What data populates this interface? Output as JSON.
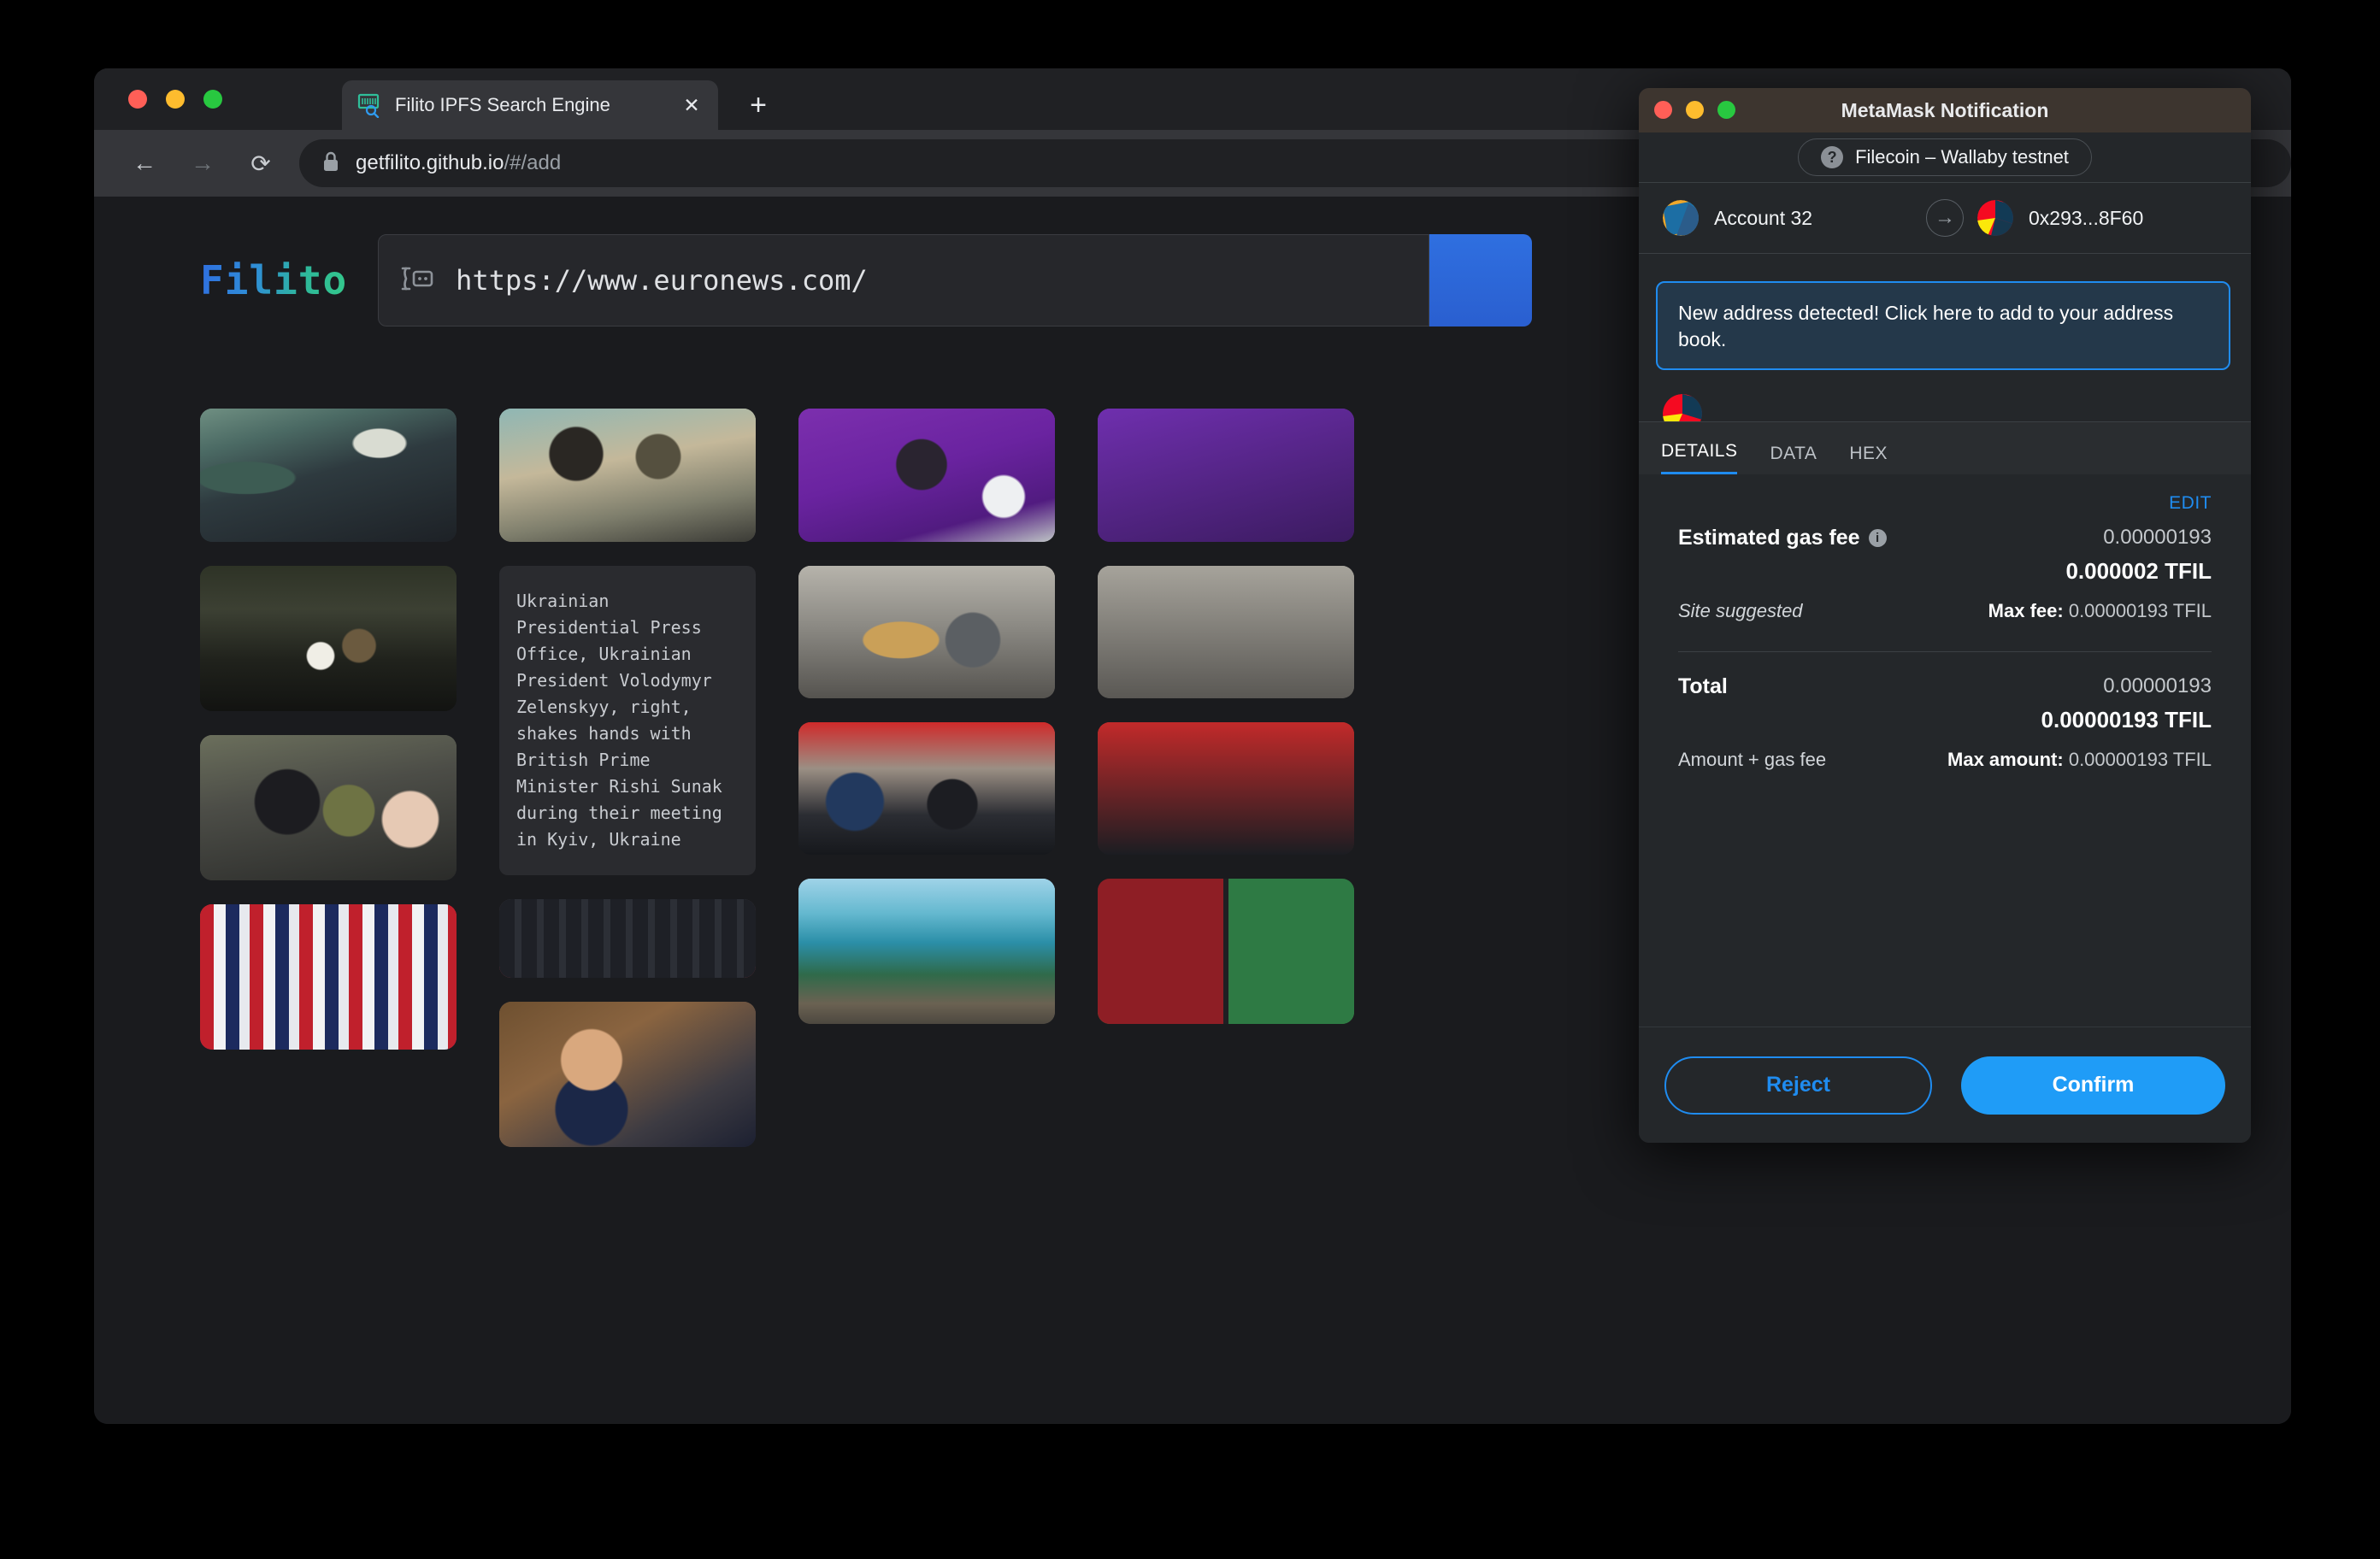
{
  "browser": {
    "tab": {
      "title": "Filito IPFS Search Engine",
      "favicon": "barcode-search-icon",
      "close_label": "✕"
    },
    "new_tab_label": "+",
    "nav": {
      "back": "←",
      "forward": "→",
      "reload": "⟳"
    },
    "omnibox": {
      "lock_icon": "lock-icon",
      "domain": "getfilito.github.io",
      "path": "/#/add"
    },
    "traffic_lights": [
      "close",
      "minimize",
      "maximize"
    ]
  },
  "page": {
    "logo_text": "Filito",
    "search": {
      "icon": "ipfs-cube-icon",
      "value": "https://www.euronews.com/",
      "submit_label": ""
    },
    "grid": {
      "columns": [
        {
          "items": [
            {
              "type": "image",
              "name": "military-funeral-coffin",
              "height": 156
            },
            {
              "type": "image",
              "name": "kim-jong-un-daughter-missile",
              "height": 170
            },
            {
              "type": "image",
              "name": "soldier-kiss-reunion",
              "height": 170
            },
            {
              "type": "image",
              "name": "budweiser-world-is-yours-collage",
              "height": 170
            }
          ]
        },
        {
          "items": [
            {
              "type": "image",
              "name": "sunak-zelenskyy-handshake",
              "height": 156
            },
            {
              "type": "text",
              "name": "caption-card",
              "text": "Ukrainian Presidential Press Office, Ukrainian President Volodymyr Zelenskyy, right, shakes hands with British Prime Minister Rishi Sunak during their meeting in Kyiv, Ukraine"
            },
            {
              "type": "image",
              "name": "red-carpet-lineup",
              "height": 90
            },
            {
              "type": "image",
              "name": "donald-trump-portrait",
              "height": 170
            }
          ]
        },
        {
          "items": [
            {
              "type": "image",
              "name": "fifa-infantino-press-conference",
              "height": 156
            },
            {
              "type": "image",
              "name": "baker-bread-oven",
              "height": 155
            },
            {
              "type": "image",
              "name": "istanbul-memorial-crowd",
              "height": 155
            },
            {
              "type": "image",
              "name": "coastal-sea-rocks",
              "height": 170
            }
          ]
        },
        {
          "items": [
            {
              "type": "image",
              "name": "hidden-card-upper",
              "height": 156
            },
            {
              "type": "image",
              "name": "hidden-card-mid",
              "height": 155
            },
            {
              "type": "image",
              "name": "hidden-card-lower",
              "height": 155
            },
            {
              "type": "image",
              "name": "football-highlights-collage",
              "height": 170
            }
          ]
        }
      ]
    }
  },
  "metamask": {
    "window_title": "MetaMask Notification",
    "network": {
      "icon": "question-mark-icon",
      "name": "Filecoin – Wallaby testnet"
    },
    "from_account": {
      "label": "Account 32",
      "identicon": "blue-orange-identicon"
    },
    "to_account": {
      "label": "0x293...8F60",
      "identicon": "red-yellow-navy-identicon"
    },
    "transfer_arrow": "→",
    "address_banner": "New address detected! Click here to add to your address book.",
    "tabs": [
      {
        "label": "DETAILS",
        "active": true
      },
      {
        "label": "DATA",
        "active": false
      },
      {
        "label": "HEX",
        "active": false
      }
    ],
    "edit_label": "EDIT",
    "gas": {
      "label": "Estimated gas fee",
      "info_icon": "info-icon",
      "alt_value": "0.00000193",
      "main_value": "0.000002 TFIL",
      "sub_left": "Site suggested",
      "sub_right_label": "Max fee:",
      "sub_right_value": "0.00000193 TFIL"
    },
    "total": {
      "label": "Total",
      "alt_value": "0.00000193",
      "main_value": "0.00000193 TFIL",
      "sub_left": "Amount + gas fee",
      "sub_right_label": "Max amount:",
      "sub_right_value": "0.00000193 TFIL"
    },
    "buttons": {
      "reject": "Reject",
      "confirm": "Confirm"
    },
    "colors": {
      "accent": "#1f8cf0",
      "confirm_bg": "#1f9cf7",
      "titlebar": "#3d352f",
      "body": "#24272a"
    }
  }
}
